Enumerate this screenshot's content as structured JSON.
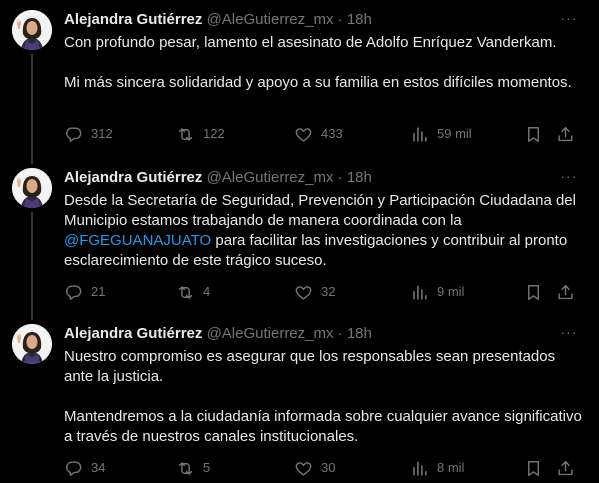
{
  "tweets": [
    {
      "name": "Alejandra Gutiérrez",
      "handle": "@AleGutierrez_mx",
      "separator": "·",
      "time": "18h",
      "more": "···",
      "p1": "Con profundo pesar, lamento el asesinato de Adolfo Enríquez Vanderkam.",
      "p2": "Mi más sincera solidaridad y apoyo a su familia en estos difíciles momentos.",
      "replies": "312",
      "reposts": "122",
      "likes": "433",
      "views": "59 mil"
    },
    {
      "name": "Alejandra Gutiérrez",
      "handle": "@AleGutierrez_mx",
      "separator": "·",
      "time": "18h",
      "more": "···",
      "p1_before": "Desde la Secretaría de Seguridad, Prevención y Participación Ciudadana del Municipio estamos trabajando de manera coordinada con la ",
      "mention": "@FGEGUANAJUATO",
      "p1_after": " para facilitar las investigaciones y contribuir al pronto esclarecimiento de este trágico suceso.",
      "replies": "21",
      "reposts": "4",
      "likes": "32",
      "views": "9 mil"
    },
    {
      "name": "Alejandra Gutiérrez",
      "handle": "@AleGutierrez_mx",
      "separator": "·",
      "time": "18h",
      "more": "···",
      "p1": "Nuestro compromiso es asegurar que los responsables sean presentados ante la justicia.",
      "p2": "Mantendremos a la ciudadanía informada sobre cualquier avance significativo a través de nuestros canales institucionales.",
      "replies": "34",
      "reposts": "5",
      "likes": "30",
      "views": "8 mil"
    }
  ],
  "icons": {
    "reply": "reply-icon",
    "repost": "repost-icon",
    "like": "like-icon",
    "views": "views-icon",
    "bookmark": "bookmark-icon",
    "share": "share-icon"
  },
  "colors": {
    "background": "#000000",
    "text": "#e7e9ea",
    "secondary": "#71767b",
    "link": "#1d9bf0",
    "thread_line": "#333639"
  }
}
